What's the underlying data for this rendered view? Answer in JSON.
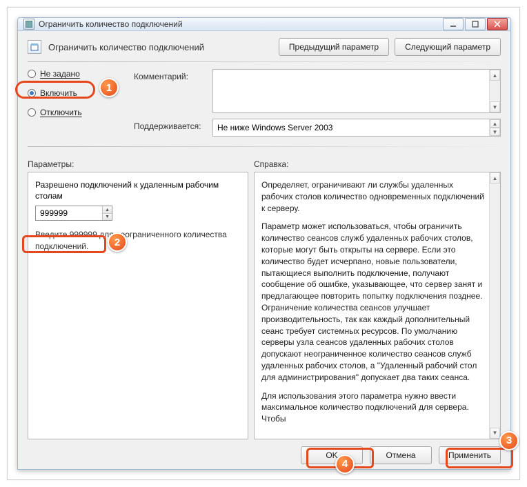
{
  "window": {
    "title": "Ограничить количество подключений"
  },
  "header": {
    "title": "Ограничить количество подключений",
    "prev_btn": "Предыдущий параметр",
    "next_btn": "Следующий параметр"
  },
  "state": {
    "not_configured_label": "Не задано",
    "enabled_label": "Включить",
    "disabled_label": "Отключить",
    "selected": "enabled"
  },
  "fields": {
    "comment_label": "Комментарий:",
    "comment_value": "",
    "supported_label": "Поддерживается:",
    "supported_value": "Не ниже Windows Server 2003"
  },
  "sections": {
    "params_label": "Параметры:",
    "help_label": "Справка:"
  },
  "params": {
    "param_title": "Разрешено подключений к удаленным рабочим столам",
    "value": "999999",
    "hint": "Введите 999999 для неограниченного количества подключений."
  },
  "help": {
    "p1": "Определяет, ограничивают ли службы удаленных рабочих столов количество одновременных подключений к серверу.",
    "p2": "Параметр может использоваться, чтобы ограничить количество сеансов служб удаленных рабочих столов, которые могут быть открыты на сервере. Если это количество будет исчерпано, новые пользователи, пытающиеся выполнить подключение, получают сообщение об ошибке, указывающее, что сервер занят и предлагающее повторить попытку подключения позднее. Ограничение количества сеансов улучшает производительность, так как каждый дополнительный сеанс требует системных ресурсов. По умолчанию серверы узла сеансов удаленных рабочих столов допускают неограниченное количество сеансов служб удаленных рабочих столов, а \"Удаленный рабочий стол для администрирования\" допускает два таких сеанса.",
    "p3": "Для использования этого параметра нужно ввести максимальное количество подключений для сервера. Чтобы"
  },
  "buttons": {
    "ok": "OK",
    "cancel": "Отмена",
    "apply": "Применить"
  },
  "markers": {
    "m1": "1",
    "m2": "2",
    "m3": "3",
    "m4": "4"
  }
}
